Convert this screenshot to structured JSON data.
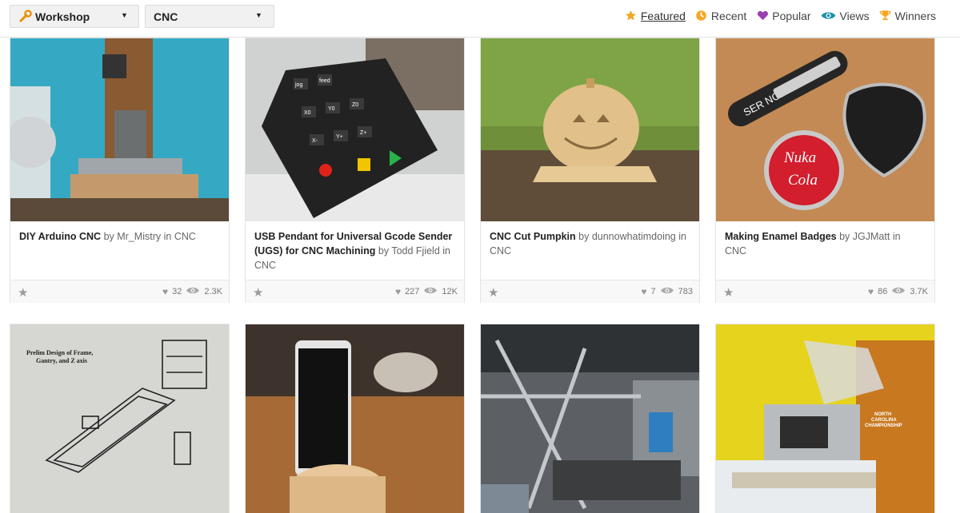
{
  "topbar": {
    "category": {
      "label": "Workshop",
      "icon": "wrench-icon"
    },
    "channel": {
      "label": "CNC"
    },
    "filters": [
      {
        "label": "Featured",
        "icon": "star-icon",
        "active": true
      },
      {
        "label": "Recent",
        "icon": "clock-icon",
        "active": false
      },
      {
        "label": "Popular",
        "icon": "heart-icon",
        "active": false
      },
      {
        "label": "Views",
        "icon": "eye-icon",
        "active": false
      },
      {
        "label": "Winners",
        "icon": "trophy-icon",
        "active": false
      }
    ]
  },
  "projects": [
    {
      "title": "DIY Arduino CNC",
      "by": "by",
      "author": "Mr_Mistry",
      "in": "in",
      "channel": "CNC",
      "favorites": "32",
      "views": "2.3K"
    },
    {
      "title": "USB Pendant for Universal Gcode Sender (UGS) for CNC Machining",
      "by": "by",
      "author": "Todd Fjield",
      "in": "in",
      "channel": "CNC",
      "favorites": "227",
      "views": "12K"
    },
    {
      "title": "CNC Cut Pumpkin",
      "by": "by",
      "author": "dunnowhatimdoing",
      "in": "in",
      "channel": "CNC",
      "favorites": "7",
      "views": "783"
    },
    {
      "title": "Making Enamel Badges",
      "by": "by",
      "author": "JGJMatt",
      "in": "in",
      "channel": "CNC",
      "favorites": "86",
      "views": "3.7K"
    }
  ],
  "thumb_text": {
    "keypad_keys": [
      "jog",
      "feed",
      "X0",
      "Y0",
      "Z0",
      "X-",
      "Y+",
      "Z+"
    ],
    "badge_plate": "SER NO.",
    "badge_round": [
      "Nuka",
      "Cola"
    ],
    "sketch_title": [
      "Prelim Design of Frame,",
      "Gantry, and Z axis"
    ],
    "banner": [
      "NORTH",
      "CAROLINA",
      "CHAMPIONSHIP"
    ]
  },
  "colors": {
    "accent_orange": "#f5a623",
    "popular_purple": "#9b3fb5",
    "views_teal": "#1a8fae"
  }
}
